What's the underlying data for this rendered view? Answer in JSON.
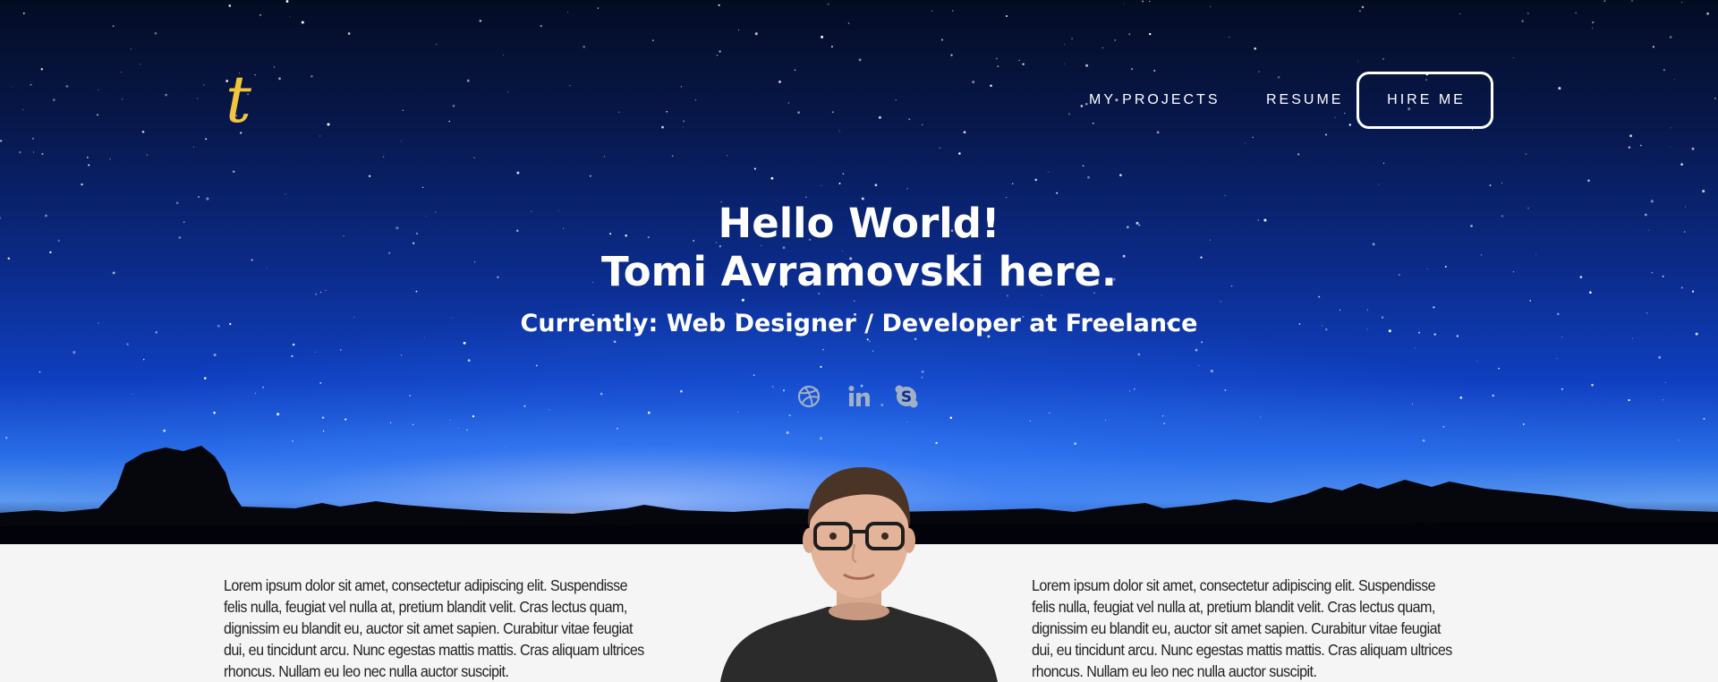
{
  "header": {
    "logo_letter": "t",
    "nav": {
      "projects_label": "MY PROJECTS",
      "resume_label": "RESUME",
      "hire_label": "HIRE ME"
    }
  },
  "hero": {
    "headline_line1": "Hello World!",
    "headline_line2": "Tomi Avramovski here.",
    "subline": "Currently: Web Designer / Developer at Freelance",
    "social_icons": [
      "dribbble-icon",
      "linkedin-icon",
      "skype-icon"
    ]
  },
  "about": {
    "left_text": "Lorem ipsum dolor sit amet, consectetur adipiscing elit. Suspendisse felis nulla, feugiat vel nulla at, pretium blandit velit. Cras lectus quam, dignissim eu blandit eu, auctor sit amet sapien. Curabitur vitae feugiat dui, eu tincidunt arcu. Nunc egestas mattis mattis. Cras aliquam ultrices rhoncus. Nullam eu leo nec nulla auctor suscipit.",
    "right_text": "Lorem ipsum dolor sit amet, consectetur adipiscing elit. Suspendisse felis nulla, feugiat vel nulla at, pretium blandit velit. Cras lectus quam, dignissim eu blandit eu, auctor sit amet sapien. Curabitur vitae feugiat dui, eu tincidunt arcu. Nunc egestas mattis mattis. Cras aliquam ultrices rhoncus. Nullam eu leo nec nulla auctor suscipit."
  },
  "colors": {
    "logo_gold": "#f2c53d",
    "nav_text": "#ffffff",
    "body_background": "#f5f5f5",
    "body_text": "#222222"
  }
}
